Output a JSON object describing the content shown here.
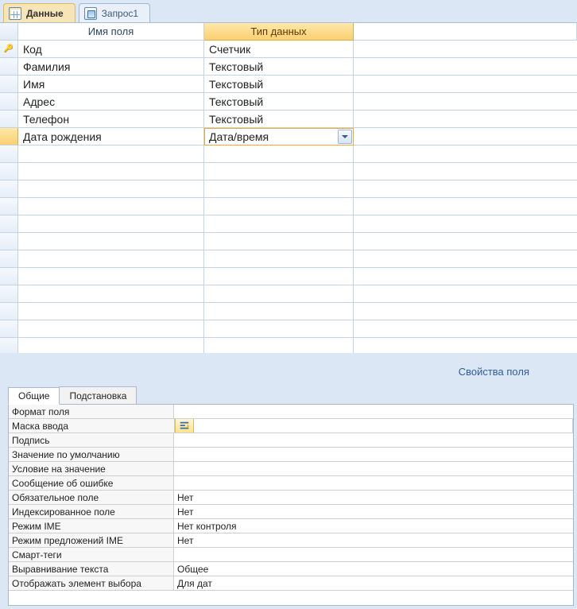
{
  "tabs": [
    {
      "label": "Данные",
      "icon": "table"
    },
    {
      "label": "Запрос1",
      "icon": "query"
    }
  ],
  "grid": {
    "headers": {
      "name": "Имя поля",
      "type": "Тип данных"
    },
    "rows": [
      {
        "name": "Код",
        "type": "Счетчик",
        "pk": true
      },
      {
        "name": "Фамилия",
        "type": "Текстовый",
        "pk": false
      },
      {
        "name": "Имя",
        "type": "Текстовый",
        "pk": false
      },
      {
        "name": "Адрес",
        "type": "Текстовый",
        "pk": false
      },
      {
        "name": "Телефон",
        "type": "Текстовый",
        "pk": false
      },
      {
        "name": "Дата рождения",
        "type": "Дата/время",
        "pk": false,
        "selected": true
      }
    ]
  },
  "props_label": "Свойства поля",
  "props_tabs": [
    "Общие",
    "Подстановка"
  ],
  "properties": [
    {
      "label": "Формат поля",
      "value": ""
    },
    {
      "label": "Маска ввода",
      "value": "",
      "active": true
    },
    {
      "label": "Подпись",
      "value": ""
    },
    {
      "label": "Значение по умолчанию",
      "value": ""
    },
    {
      "label": "Условие на значение",
      "value": ""
    },
    {
      "label": "Сообщение об ошибке",
      "value": ""
    },
    {
      "label": "Обязательное поле",
      "value": "Нет"
    },
    {
      "label": "Индексированное поле",
      "value": "Нет"
    },
    {
      "label": "Режим IME",
      "value": "Нет контроля"
    },
    {
      "label": "Режим предложений IME",
      "value": "Нет"
    },
    {
      "label": "Смарт-теги",
      "value": ""
    },
    {
      "label": "Выравнивание текста",
      "value": "Общее"
    },
    {
      "label": "Отображать элемент выбора",
      "value": "Для дат"
    }
  ]
}
